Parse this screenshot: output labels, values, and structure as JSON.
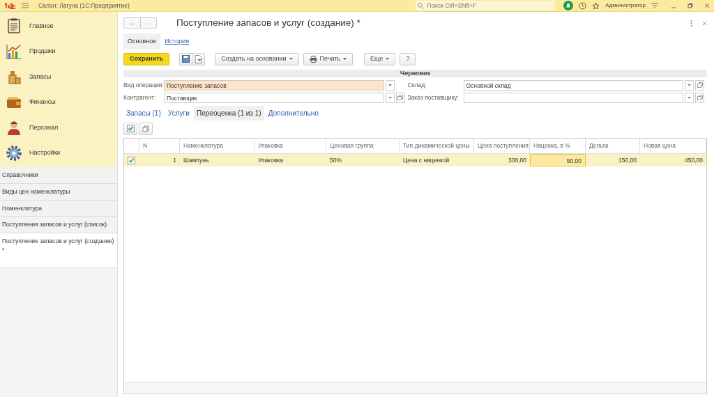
{
  "app": {
    "title": "Салон: Лагуна  (1С:Предприятие)",
    "search_placeholder": "Поиск Ctrl+Shift+F",
    "user": "Администратор"
  },
  "nav": {
    "back": "←",
    "forward": "→"
  },
  "sidebar": {
    "sections": [
      {
        "label": "Главное"
      },
      {
        "label": "Продажи"
      },
      {
        "label": "Запасы"
      },
      {
        "label": "Финансы"
      },
      {
        "label": "Персонал"
      },
      {
        "label": "Настройки"
      }
    ],
    "open_items": [
      {
        "label": "Справочники",
        "selected": false
      },
      {
        "label": "Виды цен номенклатуры",
        "selected": false
      },
      {
        "label": "Номенклатура",
        "selected": false
      },
      {
        "label": "Поступления запасов и услуг (список)",
        "selected": false
      },
      {
        "label": "Поступление запасов и услуг (создание) *",
        "selected": true
      }
    ]
  },
  "form": {
    "title": "Поступление запасов и услуг (создание) *",
    "tabs": [
      {
        "label": "Основное",
        "selected": true
      },
      {
        "label": "История",
        "selected": false
      }
    ],
    "toolbar": [
      {
        "kind": "primary",
        "label": "Сохранить"
      },
      {
        "kind": "icons"
      },
      {
        "kind": "menu",
        "label": "Создать на основании"
      },
      {
        "kind": "print",
        "label": "Печать"
      },
      {
        "kind": "menu",
        "label": "Еще"
      },
      {
        "kind": "plain",
        "label": "?"
      }
    ],
    "status": "Черновик",
    "fields": [
      {
        "label": "Вид операции:",
        "value": "Поступление запасов",
        "highlighted": true,
        "open_button": false
      },
      {
        "label": "Склад:",
        "value": "Основной склад",
        "highlighted": false,
        "open_button": true
      },
      {
        "label": "Контрагент:",
        "value": "Поставщик",
        "highlighted": false,
        "open_button": true
      },
      {
        "label": "Заказ поставщику:",
        "highlighted": false,
        "open_button": true
      }
    ],
    "subtabs": [
      {
        "label": "Запасы (1)",
        "selected": false
      },
      {
        "label": "Услуги",
        "selected": false
      },
      {
        "label": "Переоценка (1 из 1)",
        "selected": true
      },
      {
        "label": "Дополнительно",
        "selected": false
      }
    ],
    "table": {
      "columns": [
        {
          "label": "N",
          "kind": "number"
        },
        {
          "label": "Номенклатура",
          "kind": "text"
        },
        {
          "label": "Упаковка",
          "kind": "text"
        },
        {
          "label": "Ценовая группа",
          "kind": "text"
        },
        {
          "label": "Тип динамической цены",
          "kind": "text"
        },
        {
          "label": "Цена поступления",
          "kind": "number"
        },
        {
          "label": "Наценка, в %",
          "kind": "number"
        },
        {
          "label": "Дельта",
          "kind": "number"
        },
        {
          "label": "Новая цена",
          "kind": "number"
        }
      ],
      "rows": [
        {
          "checked": true,
          "selected": true,
          "cells": [
            {
              "text": "1",
              "editing": false
            },
            {
              "text": "Шампунь",
              "editing": false
            },
            {
              "text": "Упаковка",
              "editing": false
            },
            {
              "text": "50%",
              "editing": false
            },
            {
              "text": "Цена с наценкой",
              "editing": false
            },
            {
              "text": "300,00",
              "editing": false
            },
            {
              "text": "50,00",
              "editing": true
            },
            {
              "text": "150,00",
              "editing": false
            },
            {
              "text": "450,00",
              "editing": false
            }
          ]
        }
      ]
    }
  }
}
